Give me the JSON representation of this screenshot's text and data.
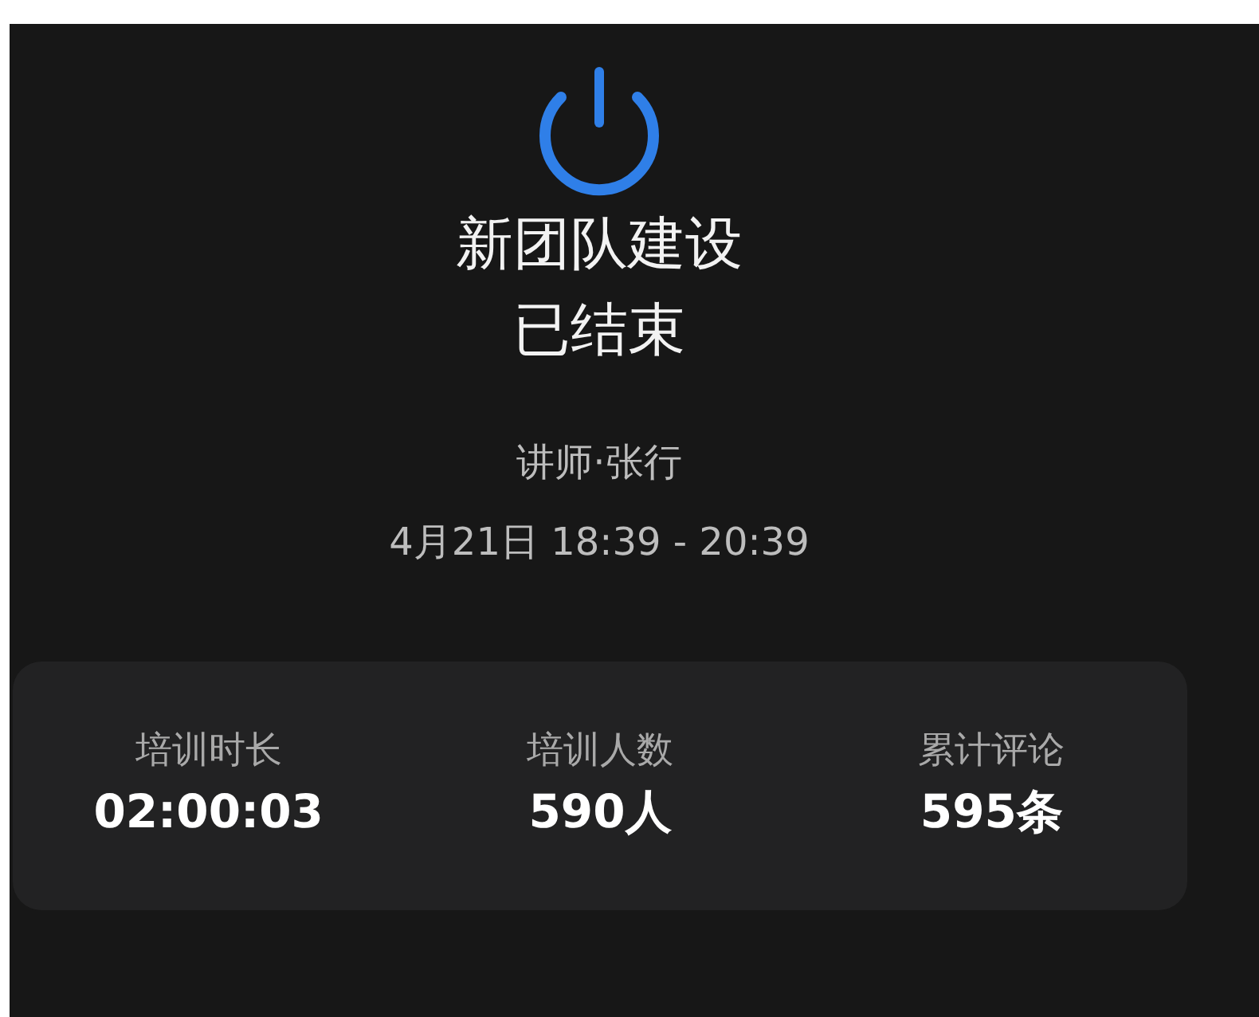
{
  "status_icon": {
    "kind": "power"
  },
  "title_lines": [
    "新团队建设",
    "已结束"
  ],
  "lecturer": "讲师·张行",
  "time_range": "4月21日 18:39 - 20:39",
  "stats": [
    {
      "label": "培训时长",
      "value": "02:00:03"
    },
    {
      "label": "培训人数",
      "value": "590人"
    },
    {
      "label": "累计评论",
      "value": "595条"
    }
  ]
}
